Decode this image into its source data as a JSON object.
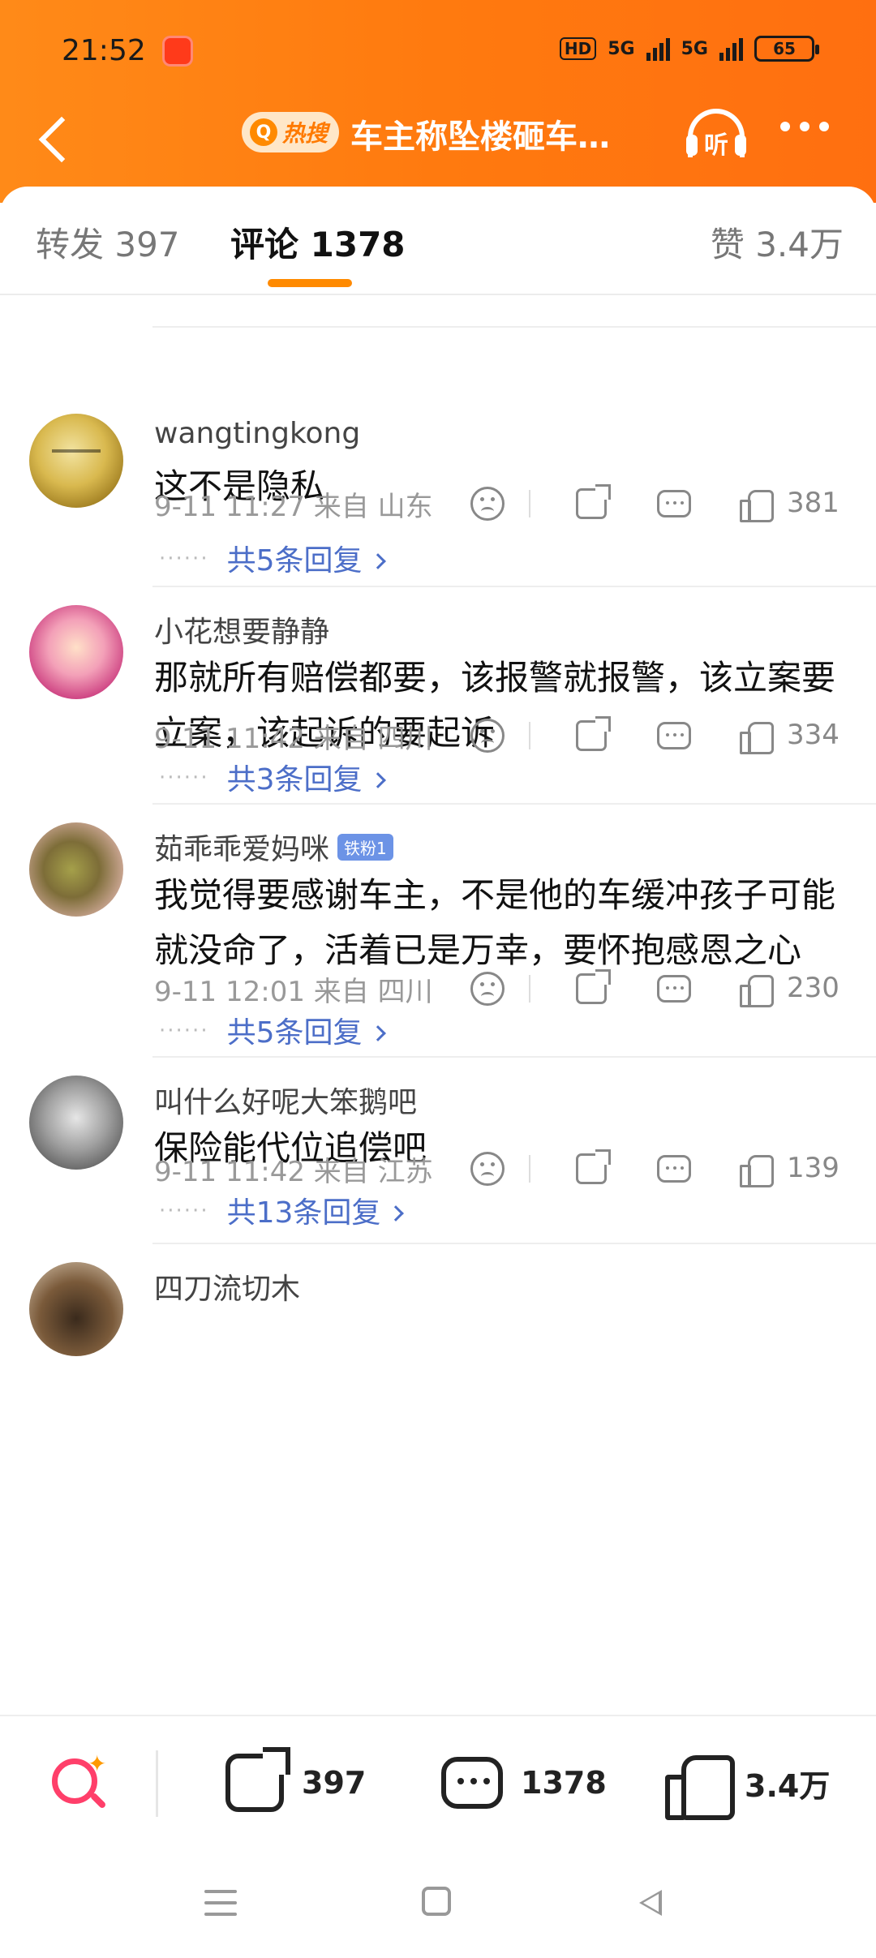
{
  "status_bar": {
    "time": "21:52",
    "hd": "HD",
    "net1": "5G",
    "net2": "5G",
    "battery": "65"
  },
  "nav": {
    "hot_badge_label": "热搜",
    "title": "车主称坠楼砸车…",
    "listen_label": "听"
  },
  "tabs": {
    "repost": "转发 397",
    "comment": "评论 1378",
    "like": "赞 3.4万"
  },
  "comments": [
    {
      "username": "wangtingkong",
      "text": "这不是隐私",
      "meta": "9-11 11:27  来自 山东",
      "likes": "381",
      "replies": "共5条回复"
    },
    {
      "username": "小花想要静静",
      "text": "那就所有赔偿都要，该报警就报警，该立案要立案，该起诉的要起诉",
      "meta": "9-11 11:42  来自 四川",
      "likes": "334",
      "replies": "共3条回复"
    },
    {
      "username": "茹乖乖爱妈咪",
      "badge": "铁粉1",
      "text": "我觉得要感谢车主，不是他的车缓冲孩子可能就没命了，活着已是万幸，要怀抱感恩之心",
      "meta": "9-11 12:01  来自 四川",
      "likes": "230",
      "replies": "共5条回复"
    },
    {
      "username": "叫什么好呢大笨鹅吧",
      "text": "保险能代位追偿吧",
      "meta": "9-11 11:42  来自 江苏",
      "likes": "139",
      "replies": "共13条回复"
    },
    {
      "username": "四刀流切木"
    }
  ],
  "bottom_bar": {
    "repost_count": "397",
    "comment_count": "1378",
    "like_count": "3.4万"
  },
  "colors": {
    "header": "#ff7a0f",
    "accent": "#ff8a00",
    "link": "#4c6ec8"
  }
}
